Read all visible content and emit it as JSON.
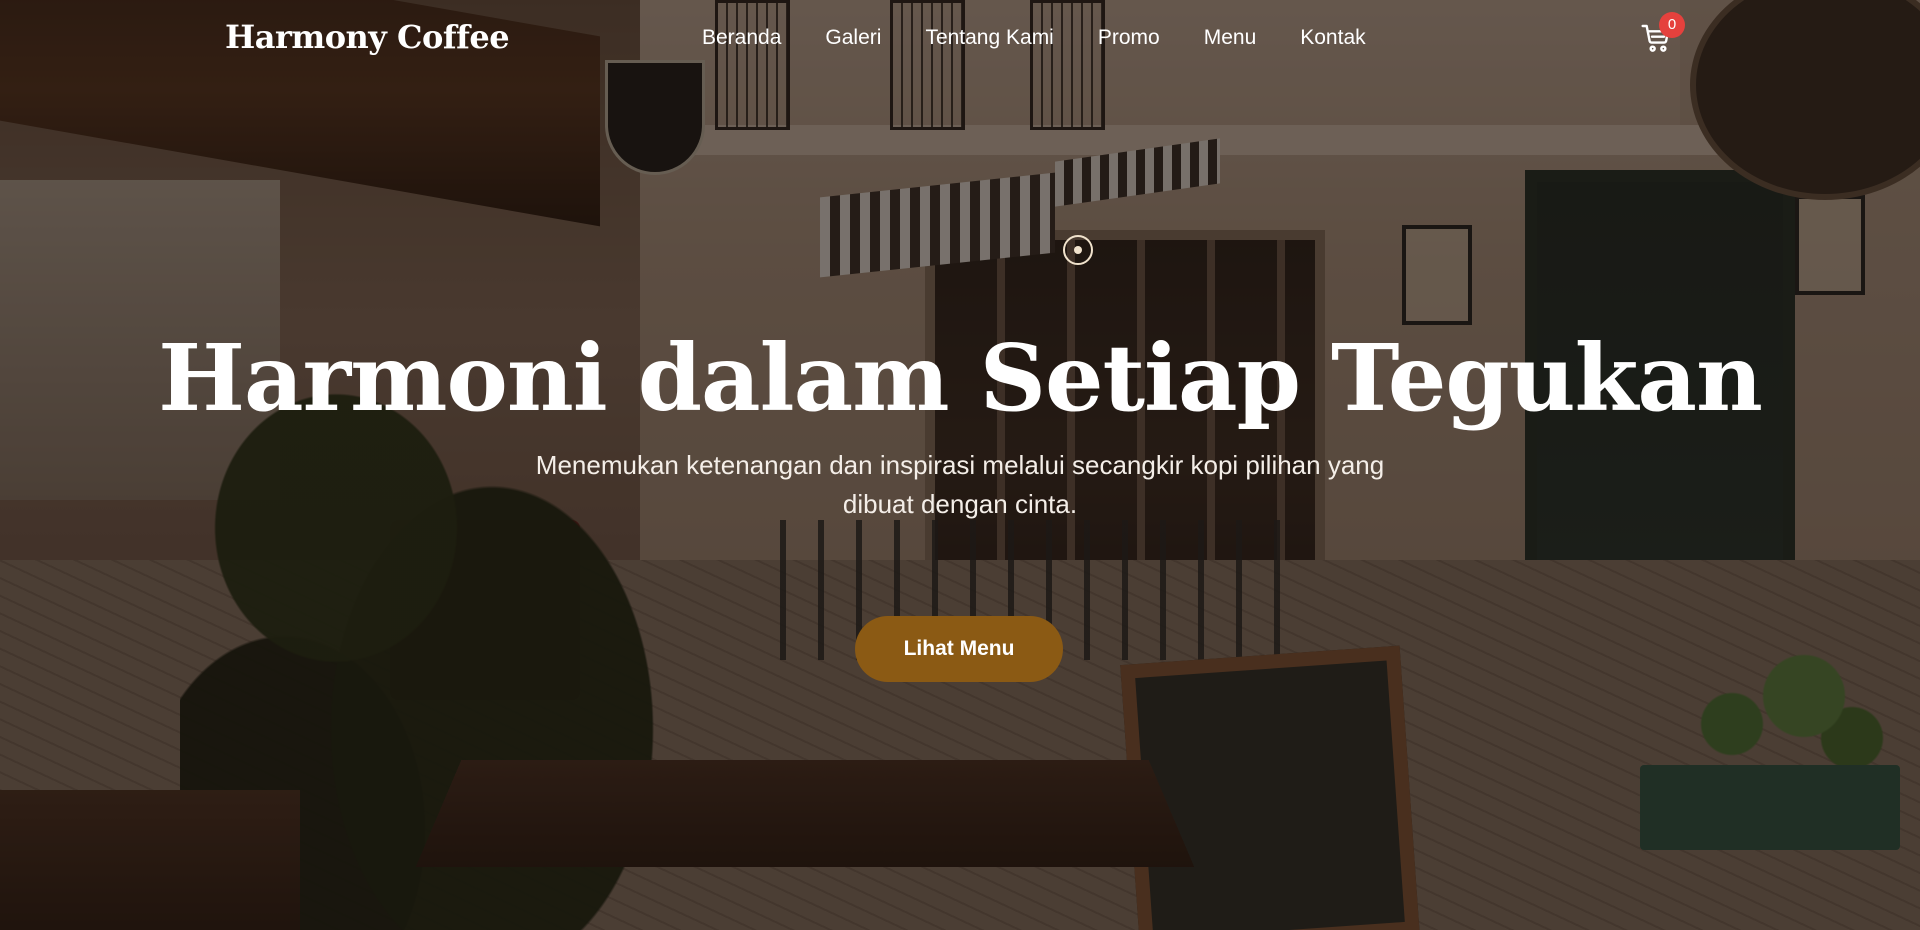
{
  "navbar": {
    "brand": "Harmony Coffee",
    "links": [
      "Beranda",
      "Galeri",
      "Tentang Kami",
      "Promo",
      "Menu",
      "Kontak"
    ],
    "cart_icon": "cart-icon",
    "cart_count": "0"
  },
  "hero": {
    "title": "Harmoni dalam Setiap Tegukan",
    "subtitle": "Menemukan ketenangan dan inspirasi melalui secangkir kopi pilihan yang dibuat dengan cinta.",
    "cta_label": "Lihat Menu",
    "slide_indicator_icon": "carousel-dot-icon"
  },
  "colors": {
    "cta_background": "#8b5a14",
    "cart_badge": "#e5413d",
    "text": "#ffffff"
  }
}
